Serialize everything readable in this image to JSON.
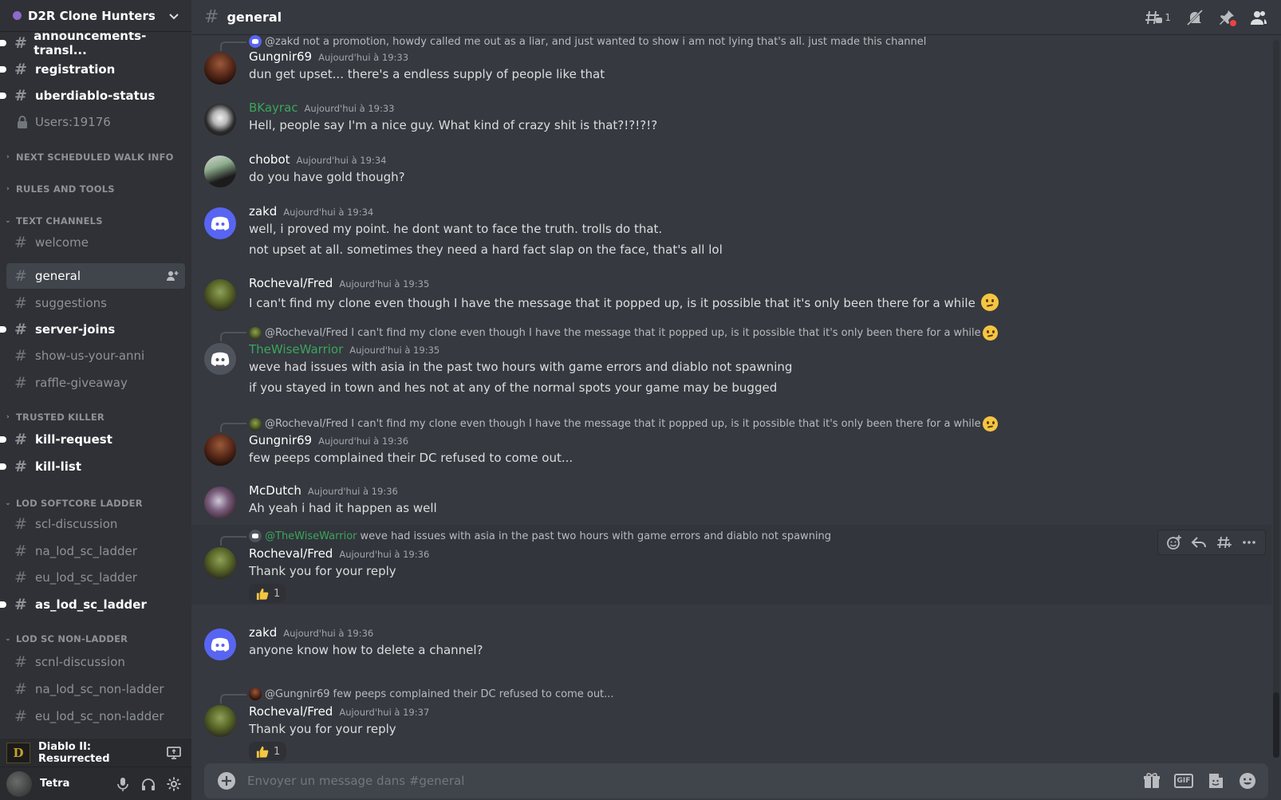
{
  "guild": {
    "name": "D2R Clone Hunters"
  },
  "channel": {
    "name": "general",
    "threads_count": "1"
  },
  "sidebar": {
    "channels_top": [
      {
        "name": "announcements-transl...",
        "unread": true
      },
      {
        "name": "registration",
        "unread": true
      },
      {
        "name": "uberdiablo-status",
        "unread": true
      },
      {
        "name": "Users:19176",
        "locked": true
      }
    ],
    "categories": {
      "walk_info": "NEXT SCHEDULED WALK INFO",
      "rules": "RULES AND TOOLS",
      "text": "TEXT CHANNELS",
      "trusted": "TRUSTED KILLER",
      "softcore": "LOD SOFTCORE LADDER",
      "nonladder": "LOD SC NON-LADDER"
    },
    "text_channels": [
      "welcome",
      "general",
      "suggestions",
      "server-joins",
      "show-us-your-anni",
      "raffle-giveaway"
    ],
    "trusted_channels": [
      "kill-request",
      "kill-list"
    ],
    "softcore_channels": [
      "scl-discussion",
      "na_lod_sc_ladder",
      "eu_lod_sc_ladder",
      "as_lod_sc_ladder"
    ],
    "nonladder_channels": [
      "scnl-discussion",
      "na_lod_sc_non-ladder",
      "eu_lod_sc_non-ladder"
    ]
  },
  "activity": {
    "game": "Diablo II: Resurrected",
    "icon_text": "D"
  },
  "user": {
    "name": "Tetra"
  },
  "messages": [
    {
      "reply_name": "@zakd",
      "reply_text": "not a promotion, howdy called me out as a liar, and just wanted to show i am not lying that's all. just made this channel"
    },
    {
      "author": "Gungnir69",
      "time": "Aujourd'hui à 19:33",
      "lines": [
        "dun get upset... there's a endless supply of people like that"
      ]
    },
    {
      "author": "BKayrac",
      "time": "Aujourd'hui à 19:33",
      "lines": [
        "Hell, people say I'm a nice guy. What kind of crazy shit is that?!?!?!?"
      ]
    },
    {
      "author": "chobot",
      "time": "Aujourd'hui à 19:34",
      "lines": [
        "do you have gold though?"
      ]
    },
    {
      "author": "zakd",
      "time": "Aujourd'hui à 19:34",
      "lines": [
        "well, i proved my point. he dont want to face the truth. trolls do that.",
        "not upset at all. sometimes they need a hard fact slap on the face, that's all lol"
      ]
    },
    {
      "author": "Rocheval/Fred",
      "time": "Aujourd'hui à 19:35",
      "lines": [
        "I can't find my clone even though I have the message that it popped up, is it possible that it's only been there for a while"
      ]
    },
    {
      "reply_name": "@Rocheval/Fred",
      "reply_text": "I can't find my clone even though I have the message that it popped up, is it possible that it's only been there for a while",
      "author": "TheWiseWarrior",
      "time": "Aujourd'hui à 19:35",
      "lines": [
        "weve had issues with asia in the past two hours with game errors and diablo not spawning",
        "if you stayed in town and hes not at any of the normal spots your game may be bugged"
      ]
    },
    {
      "reply_name": "@Rocheval/Fred",
      "reply_text": "I can't find my clone even though I have the message that it popped up, is it possible that it's only been there for a while",
      "author": "Gungnir69",
      "time": "Aujourd'hui à 19:36",
      "lines": [
        "few peeps complained their DC refused to come out..."
      ]
    },
    {
      "author": "McDutch",
      "time": "Aujourd'hui à 19:36",
      "lines": [
        "Ah yeah i had it happen as well"
      ]
    },
    {
      "reply_name": "@TheWiseWarrior",
      "reply_text": "weve had issues with asia in the past two hours with game errors and diablo not spawning",
      "author": "Rocheval/Fred",
      "time": "Aujourd'hui à 19:36",
      "lines": [
        "Thank you for your reply"
      ],
      "reaction_count": "1"
    },
    {
      "author": "zakd",
      "time": "Aujourd'hui à 19:36",
      "lines": [
        "anyone know how to delete a channel?"
      ]
    },
    {
      "reply_name": "@Gungnir69",
      "reply_text": "few peeps complained their DC refused to come out...",
      "author": "Rocheval/Fred",
      "time": "Aujourd'hui à 19:37",
      "lines": [
        "Thank you for your reply"
      ],
      "reaction_count": "1"
    }
  ],
  "composer": {
    "placeholder": "Envoyer un message dans #general",
    "gif_label": "GIF"
  },
  "colors": {
    "background": "#36393f",
    "sidebar": "#2f3136",
    "blurple": "#5865f2",
    "green_name": "#3ba55d"
  }
}
